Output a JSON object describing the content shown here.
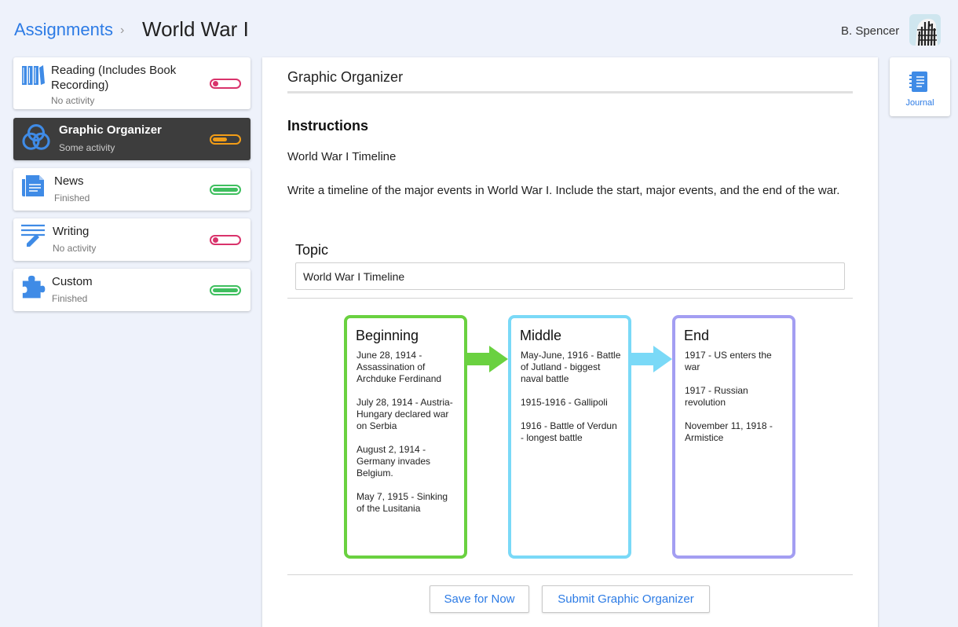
{
  "header": {
    "breadcrumb_link": "Assignments",
    "breadcrumb_separator": "›",
    "title": "World War I",
    "user_name": "B. Spencer"
  },
  "colors": {
    "accent": "#2c7be5",
    "no_activity": "#d9336b",
    "some_activity": "#f29d17",
    "finished": "#3fbf5f",
    "beginning": "#6ad140",
    "middle": "#7ad9f7",
    "end": "#a39ef2"
  },
  "sidebar": {
    "items": [
      {
        "label": "Reading (Includes Book Recording)",
        "status": "No activity",
        "icon": "books-icon",
        "progress": "none"
      },
      {
        "label": "Graphic Organizer",
        "status": "Some activity",
        "icon": "venn-diagram-icon",
        "progress": "some"
      },
      {
        "label": "News",
        "status": "Finished",
        "icon": "news-document-icon",
        "progress": "finished"
      },
      {
        "label": "Writing",
        "status": "No activity",
        "icon": "pencil-lines-icon",
        "progress": "none"
      },
      {
        "label": "Custom",
        "status": "Finished",
        "icon": "puzzle-piece-icon",
        "progress": "finished"
      }
    ]
  },
  "main": {
    "title": "Graphic Organizer",
    "instructions_heading": "Instructions",
    "instructions_subtitle": "World War I Timeline",
    "instructions_body": "Write a timeline of the major events in World War I. Include the start, major events, and the end of the war.",
    "topic_label": "Topic",
    "topic_value": "World War I Timeline",
    "organizer": {
      "boxes": [
        {
          "title": "Beginning",
          "text": "June 28, 1914 - Assassination of Archduke Ferdinand\n\nJuly 28, 1914 - Austria-Hungary declared war on Serbia\n\nAugust 2, 1914 - Germany invades Belgium.\n\nMay 7, 1915 - Sinking of the Lusitania"
        },
        {
          "title": "Middle",
          "text": "May-June, 1916 - Battle of Jutland - biggest naval battle\n\n1915-1916 - Gallipoli\n\n1916 - Battle of Verdun - longest battle"
        },
        {
          "title": "End",
          "text": "1917 - US enters the war\n\n1917 - Russian revolution\n\nNovember 11, 1918 - Armistice"
        }
      ]
    },
    "buttons": {
      "save": "Save for Now",
      "submit": "Submit Graphic Organizer"
    }
  },
  "journal": {
    "label": "Journal",
    "icon": "notebook-icon"
  }
}
